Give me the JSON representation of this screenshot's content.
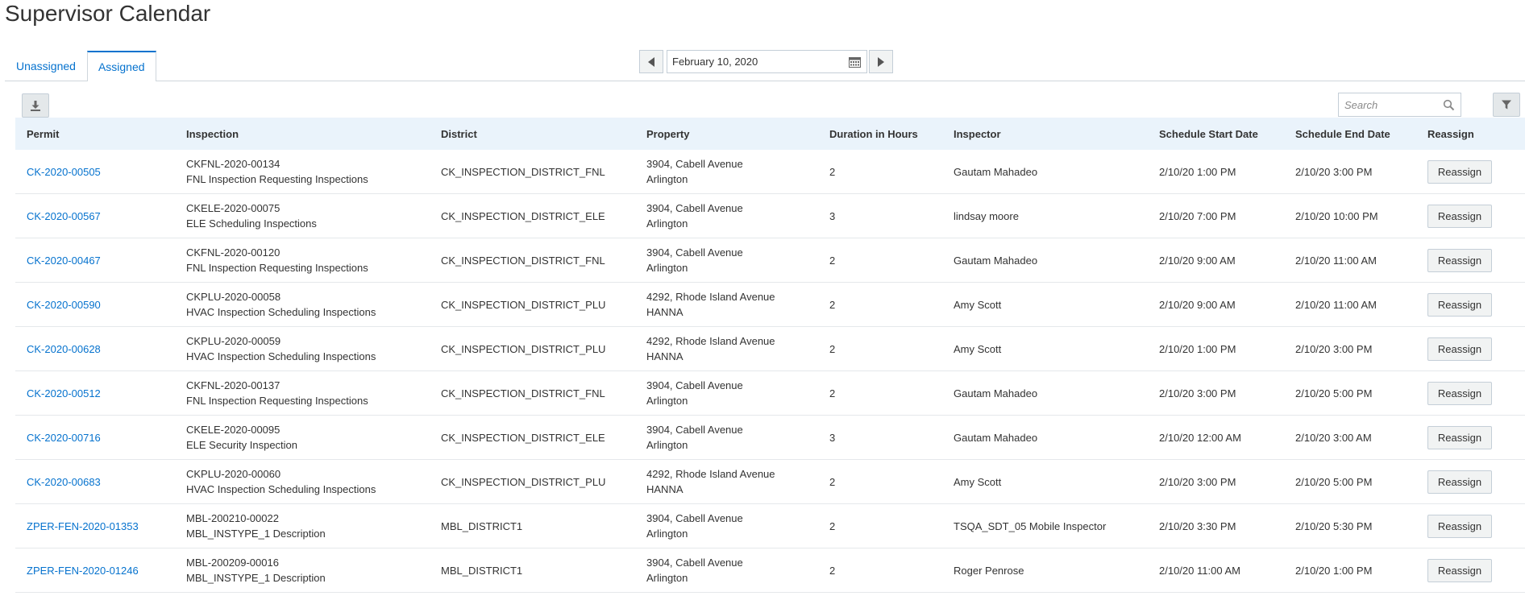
{
  "page": {
    "title": "Supervisor Calendar"
  },
  "tabs": [
    {
      "label": "Unassigned",
      "active": false
    },
    {
      "label": "Assigned",
      "active": true
    }
  ],
  "date_nav": {
    "value": "February 10, 2020"
  },
  "search": {
    "placeholder": "Search"
  },
  "table": {
    "columns": [
      "Permit",
      "Inspection",
      "District",
      "Property",
      "Duration in Hours",
      "Inspector",
      "Schedule Start Date",
      "Schedule End Date",
      "Reassign"
    ],
    "action_label": "Reassign",
    "rows": [
      {
        "permit": "CK-2020-00505",
        "inspection_id": "CKFNL-2020-00134",
        "inspection_desc": "FNL Inspection Requesting Inspections",
        "district": "CK_INSPECTION_DISTRICT_FNL",
        "property_line1": "3904, Cabell Avenue",
        "property_line2": "Arlington",
        "duration": "2",
        "inspector": "Gautam Mahadeo",
        "start": "2/10/20 1:00 PM",
        "end": "2/10/20 3:00 PM"
      },
      {
        "permit": "CK-2020-00567",
        "inspection_id": "CKELE-2020-00075",
        "inspection_desc": "ELE Scheduling Inspections",
        "district": "CK_INSPECTION_DISTRICT_ELE",
        "property_line1": "3904, Cabell Avenue",
        "property_line2": "Arlington",
        "duration": "3",
        "inspector": "lindsay moore",
        "start": "2/10/20 7:00 PM",
        "end": "2/10/20 10:00 PM"
      },
      {
        "permit": "CK-2020-00467",
        "inspection_id": "CKFNL-2020-00120",
        "inspection_desc": "FNL Inspection Requesting Inspections",
        "district": "CK_INSPECTION_DISTRICT_FNL",
        "property_line1": "3904, Cabell Avenue",
        "property_line2": "Arlington",
        "duration": "2",
        "inspector": "Gautam Mahadeo",
        "start": "2/10/20 9:00 AM",
        "end": "2/10/20 11:00 AM"
      },
      {
        "permit": "CK-2020-00590",
        "inspection_id": "CKPLU-2020-00058",
        "inspection_desc": "HVAC Inspection Scheduling Inspections",
        "district": "CK_INSPECTION_DISTRICT_PLU",
        "property_line1": "4292, Rhode Island Avenue",
        "property_line2": "HANNA",
        "duration": "2",
        "inspector": "Amy Scott",
        "start": "2/10/20 9:00 AM",
        "end": "2/10/20 11:00 AM"
      },
      {
        "permit": "CK-2020-00628",
        "inspection_id": "CKPLU-2020-00059",
        "inspection_desc": "HVAC Inspection Scheduling Inspections",
        "district": "CK_INSPECTION_DISTRICT_PLU",
        "property_line1": "4292, Rhode Island Avenue",
        "property_line2": "HANNA",
        "duration": "2",
        "inspector": "Amy Scott",
        "start": "2/10/20 1:00 PM",
        "end": "2/10/20 3:00 PM"
      },
      {
        "permit": "CK-2020-00512",
        "inspection_id": "CKFNL-2020-00137",
        "inspection_desc": "FNL Inspection Requesting Inspections",
        "district": "CK_INSPECTION_DISTRICT_FNL",
        "property_line1": "3904, Cabell Avenue",
        "property_line2": "Arlington",
        "duration": "2",
        "inspector": "Gautam Mahadeo",
        "start": "2/10/20 3:00 PM",
        "end": "2/10/20 5:00 PM"
      },
      {
        "permit": "CK-2020-00716",
        "inspection_id": "CKELE-2020-00095",
        "inspection_desc": "ELE Security Inspection",
        "district": "CK_INSPECTION_DISTRICT_ELE",
        "property_line1": "3904, Cabell Avenue",
        "property_line2": "Arlington",
        "duration": "3",
        "inspector": "Gautam Mahadeo",
        "start": "2/10/20 12:00 AM",
        "end": "2/10/20 3:00 AM"
      },
      {
        "permit": "CK-2020-00683",
        "inspection_id": "CKPLU-2020-00060",
        "inspection_desc": "HVAC Inspection Scheduling Inspections",
        "district": "CK_INSPECTION_DISTRICT_PLU",
        "property_line1": "4292, Rhode Island Avenue",
        "property_line2": "HANNA",
        "duration": "2",
        "inspector": "Amy Scott",
        "start": "2/10/20 3:00 PM",
        "end": "2/10/20 5:00 PM"
      },
      {
        "permit": "ZPER-FEN-2020-01353",
        "inspection_id": "MBL-200210-00022",
        "inspection_desc": "MBL_INSTYPE_1 Description",
        "district": "MBL_DISTRICT1",
        "property_line1": "3904, Cabell Avenue",
        "property_line2": "Arlington",
        "duration": "2",
        "inspector": "TSQA_SDT_05 Mobile Inspector",
        "start": "2/10/20 3:30 PM",
        "end": "2/10/20 5:30 PM"
      },
      {
        "permit": "ZPER-FEN-2020-01246",
        "inspection_id": "MBL-200209-00016",
        "inspection_desc": "MBL_INSTYPE_1 Description",
        "district": "MBL_DISTRICT1",
        "property_line1": "3904, Cabell Avenue",
        "property_line2": "Arlington",
        "duration": "2",
        "inspector": "Roger Penrose",
        "start": "2/10/20 11:00 AM",
        "end": "2/10/20 1:00 PM"
      }
    ]
  },
  "icons": {
    "download": "download-icon",
    "search": "search-icon",
    "filter": "filter-icon",
    "calendar": "calendar-icon",
    "prev": "chevron-left-icon",
    "next": "chevron-right-icon"
  },
  "colors": {
    "accent": "#0572ce",
    "header_bg": "#eaf3fb",
    "button_bg": "#f1f3f3",
    "border": "#c4ced7"
  }
}
